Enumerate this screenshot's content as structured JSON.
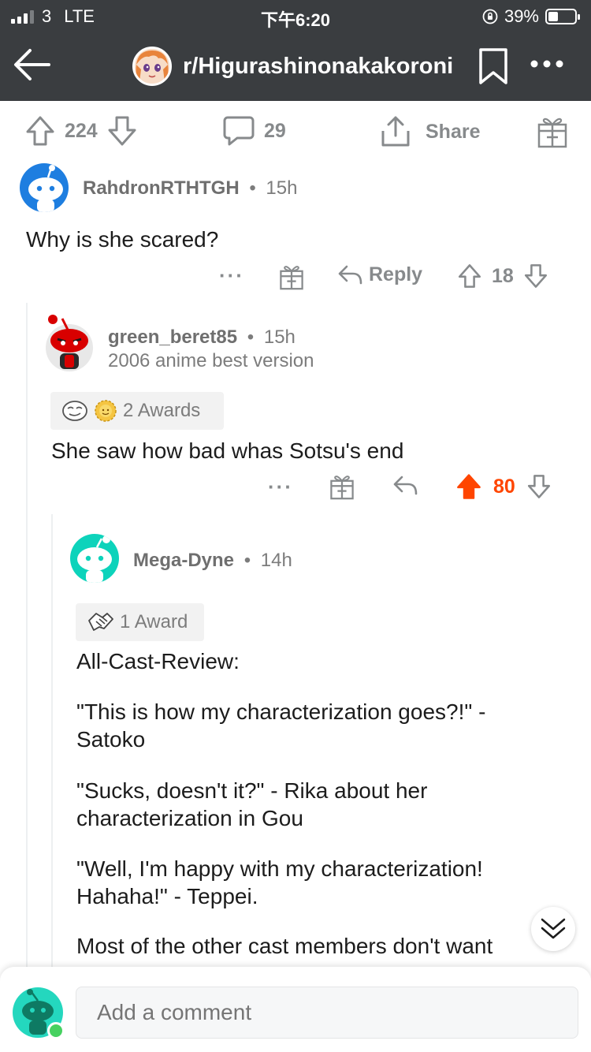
{
  "status_bar": {
    "carrier": "3",
    "network": "LTE",
    "time": "下午6:20",
    "battery": "39%",
    "battery_level": 0.39
  },
  "header": {
    "subreddit": "r/Higurashinonakakoroni",
    "icons": [
      "back-arrow-icon",
      "bookmark-icon",
      "more-icon"
    ]
  },
  "post_actions": {
    "upvotes": "224",
    "comments": "29",
    "share_label": "Share"
  },
  "comments": [
    {
      "username": "RahdronRTHTGH",
      "age": "15h",
      "body": "Why is she scared?",
      "reply_label": "Reply",
      "votes": "18",
      "upvoted": false
    },
    {
      "username": "green_beret85",
      "age": "15h",
      "flair": "2006 anime best version",
      "awards_label": "2 Awards",
      "body": "She saw how bad whas Sotsu's end",
      "votes": "80",
      "upvoted": true
    },
    {
      "username": "Mega-Dyne",
      "age": "14h",
      "awards_label": "1 Award",
      "paragraphs": [
        "All-Cast-Review:",
        "\"This is how my characterization goes?!\" - Satoko",
        "\"Sucks, doesn't it?\" - Rika about her characterization in Gou",
        "\"Well, I'm happy with my characterization! Hahaha!\" - Teppei.",
        "Most of the other cast members don't want"
      ]
    }
  ],
  "composer": {
    "placeholder": "Add a comment"
  },
  "colors": {
    "header_bg": "#3a3d40",
    "upvote_active": "#ff4500",
    "muted": "#878a8c",
    "composer_avatar": "#24d7be",
    "online": "#46d160"
  },
  "separator": "•"
}
